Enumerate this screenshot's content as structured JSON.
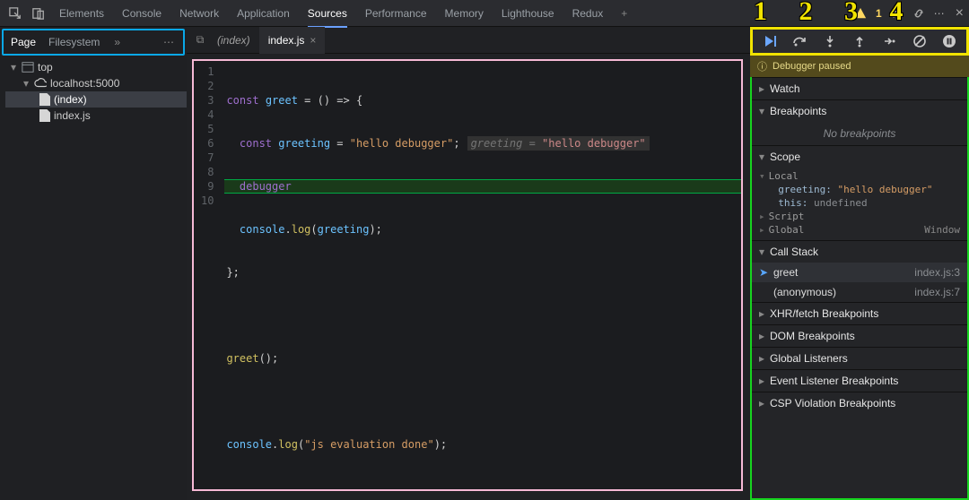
{
  "overlay": {
    "numbers": "1 2 3 4"
  },
  "topbar": {
    "tabs": [
      "Elements",
      "Console",
      "Network",
      "Application",
      "Sources",
      "Performance",
      "Memory",
      "Lighthouse",
      "Redux"
    ],
    "active": "Sources",
    "warn_count": "1"
  },
  "left": {
    "tabs": {
      "page": "Page",
      "filesystem": "Filesystem"
    },
    "tree": {
      "top": "top",
      "host": "localhost:5000",
      "index": "(index)",
      "file": "index.js"
    }
  },
  "files": {
    "tab1": "(index)",
    "tab2": "index.js"
  },
  "code": {
    "lines": {
      "n1": "1",
      "n2": "2",
      "n3": "3",
      "n4": "4",
      "n5": "5",
      "n6": "6",
      "n7": "7",
      "n8": "8",
      "n9": "9",
      "n10": "10"
    },
    "l1": {
      "const": "const ",
      "name": "greet",
      "rest": " = () => {"
    },
    "l2": {
      "const": "  const ",
      "name": "greeting",
      "eq": " = ",
      "str": "\"hello debugger\"",
      "semi": ";",
      "hint_k": "greeting",
      "hint_eq": " = ",
      "hint_v": "\"hello debugger\""
    },
    "l3": {
      "kw": "  debugger"
    },
    "l4": {
      "obj": "  console",
      "dot": ".",
      "fn": "log",
      "open": "(",
      "arg": "greeting",
      "close": ");"
    },
    "l5": "};",
    "l6": "",
    "l7": {
      "fn": "greet",
      "rest": "();"
    },
    "l8": "",
    "l9": {
      "obj": "console",
      "dot": ".",
      "fn": "log",
      "open": "(",
      "str": "\"js evaluation done\"",
      "close": ");"
    },
    "l10": ""
  },
  "debugger": {
    "paused": "Debugger paused",
    "watch": "Watch",
    "breakpoints": "Breakpoints",
    "no_bp": "No breakpoints",
    "scope": "Scope",
    "scope_body": {
      "local": "Local",
      "greeting_k": "greeting:",
      "greeting_v": "\"hello debugger\"",
      "this_k": "this:",
      "this_v": "undefined",
      "script": "Script",
      "global": "Global",
      "global_v": "Window"
    },
    "callstack": "Call Stack",
    "stack": {
      "f0_name": "greet",
      "f0_loc": "index.js:3",
      "f1_name": "(anonymous)",
      "f1_loc": "index.js:7"
    },
    "xhr": "XHR/fetch Breakpoints",
    "dom": "DOM Breakpoints",
    "gl": "Global Listeners",
    "el": "Event Listener Breakpoints",
    "csp": "CSP Violation Breakpoints"
  }
}
